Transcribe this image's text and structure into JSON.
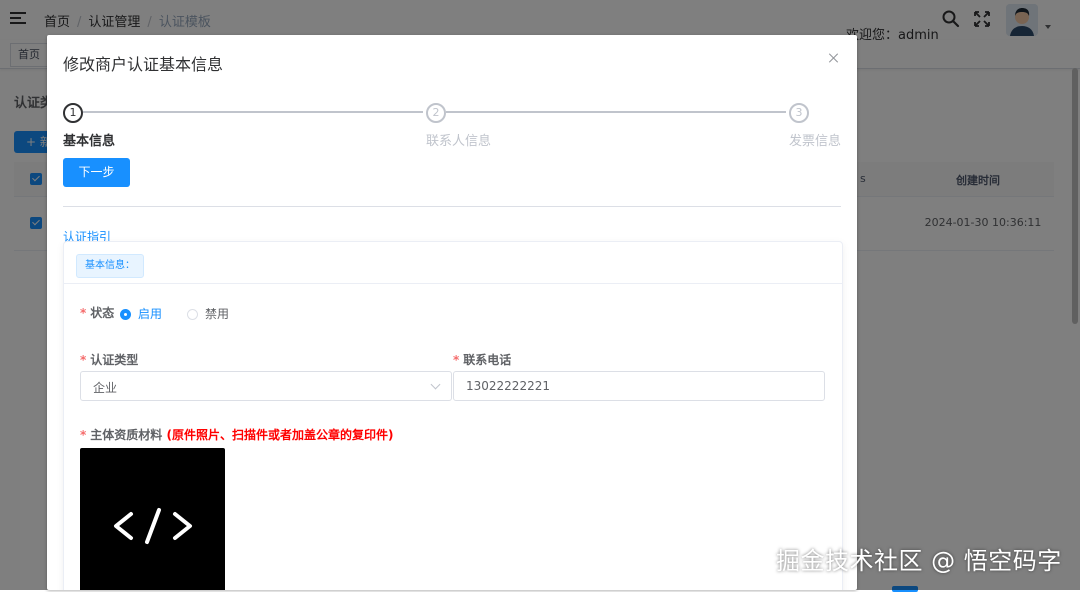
{
  "header": {
    "breadcrumb": [
      "首页",
      "认证管理",
      "认证模板"
    ],
    "welcome": "欢迎您：admin",
    "icons": [
      "menu-fold-icon",
      "search-icon",
      "fullscreen-icon",
      "avatar",
      "caret-down-icon"
    ]
  },
  "tags_view": {
    "tabs": [
      "首页"
    ]
  },
  "background": {
    "filter_label": "认证类",
    "add_button_label": "+ 新",
    "table": {
      "headers": [
        "s",
        "创建时间"
      ],
      "rows": [
        {
          "created_at": "2024-01-30 10:36:11"
        }
      ]
    }
  },
  "dialog": {
    "title": "修改商户认证基本信息",
    "steps": [
      {
        "index": "1",
        "title": "基本信息",
        "active": true
      },
      {
        "index": "2",
        "title": "联系人信息",
        "active": false
      },
      {
        "index": "3",
        "title": "发票信息",
        "active": false
      }
    ],
    "next_button": "下一步",
    "guide_link": "认证指引",
    "card_title": "基本信息：",
    "form": {
      "status": {
        "label": "状态",
        "options": [
          {
            "label": "启用",
            "checked": true
          },
          {
            "label": "禁用",
            "checked": false
          }
        ]
      },
      "cert_type": {
        "label": "认证类型",
        "value": "企业"
      },
      "phone": {
        "label": "联系电话",
        "value": "13022222221"
      },
      "material": {
        "label": "主体资质材料",
        "hint": "(原件照片、扫描件或者加盖公章的复印件)",
        "thumbnail_glyph": "</>"
      }
    }
  },
  "watermark": "掘金技术社区 @ 悟空码字",
  "colors": {
    "primary": "#1890ff",
    "required": "#f56c6c",
    "warning": "#ff0000"
  }
}
